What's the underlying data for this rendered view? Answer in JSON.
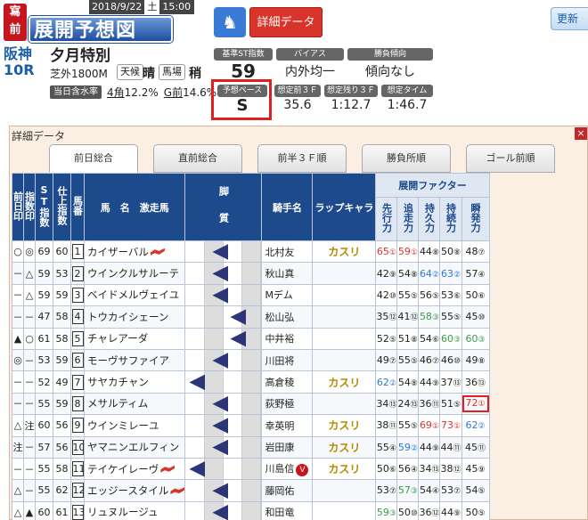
{
  "header": {
    "logo_top": "寫",
    "logo_top2": "前",
    "logo_main": "展開予想図",
    "date": "2018/9/22",
    "dow": "土",
    "time": "15:00",
    "venue": "阪神",
    "race_no": "10R",
    "race_name": "夕月特別",
    "course": "芝外1800M",
    "weather_label": "天候",
    "weather_value": "晴",
    "track_label": "馬場",
    "track_value": "稍",
    "moisture_label": "当日含水率",
    "moisture_corner4_label": "4角",
    "moisture_corner4": "12.2%",
    "moisture_goal_label": "G前",
    "moisture_goal": "14.6%",
    "detail_button": "詳細データ",
    "update_button": "更新"
  },
  "stats": {
    "base_st_label": "基準ST指数",
    "base_st_value": "59",
    "bias_label": "バイアス",
    "bias_value": "内外均一",
    "trend_label": "勝負傾向",
    "trend_value": "傾向なし",
    "pace_label": "予想ペース",
    "pace_value": "S",
    "front3f_label": "想定前３Ｆ",
    "front3f_value": "35.6",
    "remain3f_label": "想定残り３Ｆ",
    "remain3f_value": "1:12.7",
    "time_label": "想定タイム",
    "time_value": "1:46.7"
  },
  "panel": {
    "title": "詳細データ",
    "close": "×",
    "tabs": [
      "前日総合",
      "直前総合",
      "前半３Ｆ順",
      "勝負所順",
      "ゴール前順"
    ]
  },
  "table": {
    "headers": {
      "prev": "前日印",
      "idx": "指数印",
      "st": "ST指数",
      "finish": "仕上指数",
      "num": "馬番",
      "horse": "馬　名　激走馬",
      "leg": "脚　質",
      "jockey": "騎手名",
      "rap": "ラップキャラ",
      "factor": "展開ファクター",
      "f1": "先行力",
      "f2": "追走力",
      "f3": "持久力",
      "f4": "持続力",
      "f5": "瞬発力"
    },
    "rows": [
      {
        "prev": "○",
        "idx": "◎",
        "st": "69",
        "fin": "60",
        "num": "1",
        "name": "カイザーバル",
        "mark": "red",
        "leg": 0,
        "jockey": "北村友",
        "v": false,
        "rap": "カスリ",
        "f": [
          {
            "v": "65",
            "r": "①",
            "c": "red"
          },
          {
            "v": "59",
            "r": "①",
            "c": "red"
          },
          {
            "v": "44",
            "r": "⑧",
            "c": "black"
          },
          {
            "v": "50",
            "r": "⑧",
            "c": "black"
          },
          {
            "v": "48",
            "r": "⑦",
            "c": "black"
          }
        ]
      },
      {
        "prev": "－",
        "idx": "△",
        "st": "59",
        "fin": "53",
        "num": "2",
        "name": "ウインクルサルーテ",
        "mark": "",
        "leg": 0,
        "jockey": "秋山真",
        "v": false,
        "rap": "",
        "f": [
          {
            "v": "42",
            "r": "⑨",
            "c": "black"
          },
          {
            "v": "54",
            "r": "⑧",
            "c": "black"
          },
          {
            "v": "64",
            "r": "②",
            "c": "blue"
          },
          {
            "v": "63",
            "r": "②",
            "c": "blue"
          },
          {
            "v": "57",
            "r": "④",
            "c": "black"
          }
        ]
      },
      {
        "prev": "－",
        "idx": "△",
        "st": "59",
        "fin": "59",
        "num": "3",
        "name": "ベイドメルヴェイユ",
        "mark": "",
        "leg": 0,
        "jockey": "Mデム",
        "v": false,
        "rap": "",
        "f": [
          {
            "v": "42",
            "r": "⑩",
            "c": "black"
          },
          {
            "v": "55",
            "r": "⑤",
            "c": "black"
          },
          {
            "v": "56",
            "r": "⑤",
            "c": "black"
          },
          {
            "v": "53",
            "r": "⑥",
            "c": "black"
          },
          {
            "v": "50",
            "r": "⑥",
            "c": "black"
          }
        ]
      },
      {
        "prev": "－",
        "idx": "－",
        "st": "47",
        "fin": "58",
        "num": "4",
        "name": "トウカイシェーン",
        "mark": "",
        "leg": 1,
        "jockey": "松山弘",
        "v": false,
        "rap": "",
        "f": [
          {
            "v": "35",
            "r": "⑫",
            "c": "black"
          },
          {
            "v": "41",
            "r": "⑫",
            "c": "black"
          },
          {
            "v": "58",
            "r": "③",
            "c": "green"
          },
          {
            "v": "55",
            "r": "⑤",
            "c": "black"
          },
          {
            "v": "45",
            "r": "⑩",
            "c": "black"
          }
        ]
      },
      {
        "prev": "▲",
        "idx": "○",
        "st": "61",
        "fin": "58",
        "num": "5",
        "name": "チャレアーダ",
        "mark": "",
        "leg": 1,
        "jockey": "中井裕",
        "v": false,
        "rap": "",
        "f": [
          {
            "v": "52",
            "r": "⑤",
            "c": "black"
          },
          {
            "v": "51",
            "r": "⑧",
            "c": "black"
          },
          {
            "v": "54",
            "r": "⑥",
            "c": "black"
          },
          {
            "v": "60",
            "r": "③",
            "c": "green"
          },
          {
            "v": "60",
            "r": "③",
            "c": "green"
          }
        ]
      },
      {
        "prev": "◎",
        "idx": "－",
        "st": "53",
        "fin": "59",
        "num": "6",
        "name": "モーヴサファイア",
        "mark": "",
        "leg": 0,
        "jockey": "川田将",
        "v": false,
        "rap": "",
        "f": [
          {
            "v": "49",
            "r": "⑦",
            "c": "black"
          },
          {
            "v": "55",
            "r": "⑤",
            "c": "black"
          },
          {
            "v": "46",
            "r": "⑦",
            "c": "black"
          },
          {
            "v": "46",
            "r": "⑩",
            "c": "black"
          },
          {
            "v": "49",
            "r": "⑧",
            "c": "black"
          }
        ]
      },
      {
        "prev": "－",
        "idx": "－",
        "st": "52",
        "fin": "49",
        "num": "7",
        "name": "サヤカチャン",
        "mark": "",
        "leg": 2,
        "jockey": "高倉稜",
        "v": false,
        "rap": "カスリ",
        "f": [
          {
            "v": "62",
            "r": "②",
            "c": "blue"
          },
          {
            "v": "54",
            "r": "⑧",
            "c": "black"
          },
          {
            "v": "44",
            "r": "⑨",
            "c": "black"
          },
          {
            "v": "37",
            "r": "⑬",
            "c": "black"
          },
          {
            "v": "36",
            "r": "⑬",
            "c": "black"
          }
        ]
      },
      {
        "prev": "－",
        "idx": "－",
        "st": "55",
        "fin": "59",
        "num": "8",
        "name": "メサルティム",
        "mark": "",
        "leg": 0,
        "jockey": "荻野極",
        "v": false,
        "rap": "",
        "f": [
          {
            "v": "34",
            "r": "⑬",
            "c": "black"
          },
          {
            "v": "24",
            "r": "⑬",
            "c": "black"
          },
          {
            "v": "36",
            "r": "⑪",
            "c": "black"
          },
          {
            "v": "51",
            "r": "⑤",
            "c": "black"
          },
          {
            "v": "72",
            "r": "①",
            "c": "red",
            "hl": true
          }
        ]
      },
      {
        "prev": "△",
        "idx": "注",
        "st": "60",
        "fin": "56",
        "num": "9",
        "name": "ウインミレーユ",
        "mark": "",
        "leg": 0,
        "jockey": "幸英明",
        "v": false,
        "rap": "カスリ",
        "f": [
          {
            "v": "38",
            "r": "⑪",
            "c": "black"
          },
          {
            "v": "55",
            "r": "⑤",
            "c": "black"
          },
          {
            "v": "69",
            "r": "①",
            "c": "red"
          },
          {
            "v": "73",
            "r": "①",
            "c": "red"
          },
          {
            "v": "62",
            "r": "②",
            "c": "blue"
          }
        ]
      },
      {
        "prev": "注",
        "idx": "－",
        "st": "57",
        "fin": "56",
        "num": "10",
        "name": "ヤマニンエルフィン",
        "mark": "",
        "leg": 0,
        "jockey": "岩田康",
        "v": false,
        "rap": "カスリ",
        "f": [
          {
            "v": "55",
            "r": "④",
            "c": "black"
          },
          {
            "v": "59",
            "r": "②",
            "c": "blue"
          },
          {
            "v": "44",
            "r": "⑨",
            "c": "black"
          },
          {
            "v": "44",
            "r": "⑪",
            "c": "black"
          },
          {
            "v": "45",
            "r": "⑪",
            "c": "black"
          }
        ]
      },
      {
        "prev": "－",
        "idx": "－",
        "st": "55",
        "fin": "58",
        "num": "11",
        "name": "テイケイレーヴ",
        "mark": "red",
        "leg": 2,
        "jockey": "川島信",
        "v": true,
        "rap": "カスリ",
        "f": [
          {
            "v": "50",
            "r": "⑥",
            "c": "black"
          },
          {
            "v": "56",
            "r": "④",
            "c": "black"
          },
          {
            "v": "34",
            "r": "⑬",
            "c": "black"
          },
          {
            "v": "38",
            "r": "⑫",
            "c": "black"
          },
          {
            "v": "45",
            "r": "⑨",
            "c": "black"
          }
        ]
      },
      {
        "prev": "△",
        "idx": "－",
        "st": "55",
        "fin": "62",
        "num": "12",
        "name": "エッジースタイル",
        "mark": "red",
        "leg": 0,
        "jockey": "藤岡佑",
        "v": false,
        "rap": "",
        "f": [
          {
            "v": "53",
            "r": "⑦",
            "c": "black"
          },
          {
            "v": "57",
            "r": "③",
            "c": "green"
          },
          {
            "v": "54",
            "r": "④",
            "c": "black"
          },
          {
            "v": "53",
            "r": "⑦",
            "c": "black"
          },
          {
            "v": "54",
            "r": "⑤",
            "c": "black"
          }
        ]
      },
      {
        "prev": "△",
        "idx": "▲",
        "st": "60",
        "fin": "61",
        "num": "13",
        "name": "リュヌルージュ",
        "mark": "",
        "leg": 0,
        "jockey": "和田竜",
        "v": false,
        "rap": "",
        "f": [
          {
            "v": "59",
            "r": "③",
            "c": "green"
          },
          {
            "v": "50",
            "r": "⑩",
            "c": "black"
          },
          {
            "v": "36",
            "r": "⑫",
            "c": "black"
          },
          {
            "v": "44",
            "r": "⑨",
            "c": "black"
          },
          {
            "v": "50",
            "r": "⑤",
            "c": "black"
          }
        ]
      }
    ]
  }
}
